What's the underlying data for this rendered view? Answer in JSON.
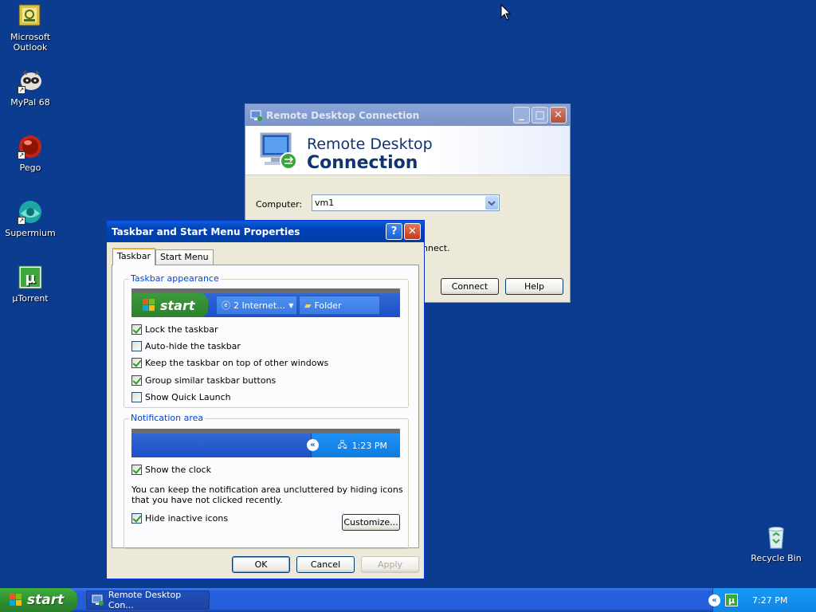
{
  "desktop": {
    "icons": [
      {
        "label": "Microsoft Outlook",
        "icon": "outlook-icon"
      },
      {
        "label": "MyPal 68",
        "icon": "mypal-icon"
      },
      {
        "label": "Pego",
        "icon": "pego-icon"
      },
      {
        "label": "Supermium",
        "icon": "supermium-icon"
      },
      {
        "label": "µTorrent",
        "icon": "utorrent-icon"
      },
      {
        "label": "Recycle Bin",
        "icon": "recycle-bin-icon"
      }
    ]
  },
  "rdc": {
    "title": "Remote Desktop Connection",
    "banner_line1": "Remote Desktop",
    "banner_line2": "Connection",
    "computer_label": "Computer:",
    "computer_value": "vm1",
    "partial_text": "nnect.",
    "connect_label": "Connect",
    "help_label": "Help"
  },
  "taskbar_props": {
    "title": "Taskbar and Start Menu Properties",
    "tabs": [
      "Taskbar",
      "Start Menu"
    ],
    "appearance_legend": "Taskbar appearance",
    "preview": {
      "start_label": "start",
      "button1_label": "2 Internet…",
      "button2_label": "Folder"
    },
    "options": [
      {
        "label": "Lock the taskbar",
        "checked": true
      },
      {
        "label": "Auto-hide the taskbar",
        "checked": false
      },
      {
        "label": "Keep the taskbar on top of other windows",
        "checked": true
      },
      {
        "label": "Group similar taskbar buttons",
        "checked": true
      },
      {
        "label": "Show Quick Launch",
        "checked": false
      }
    ],
    "notification_legend": "Notification area",
    "notif_time": "1:23 PM",
    "show_clock_label": "Show the clock",
    "show_clock_checked": true,
    "description": "You can keep the notification area uncluttered by hiding icons that you have not clicked recently.",
    "hide_inactive_label": "Hide inactive icons",
    "hide_inactive_checked": true,
    "customize_label": "Customize...",
    "ok_label": "OK",
    "cancel_label": "Cancel",
    "apply_label": "Apply"
  },
  "taskbar": {
    "start_label": "start",
    "task_label": "Remote Desktop Con...",
    "clock": "7:27 PM"
  },
  "colors": {
    "desktop_bg": "#0c3c8f",
    "titlebar_active": "#0043b8",
    "start_green": "#2e8b2e"
  }
}
